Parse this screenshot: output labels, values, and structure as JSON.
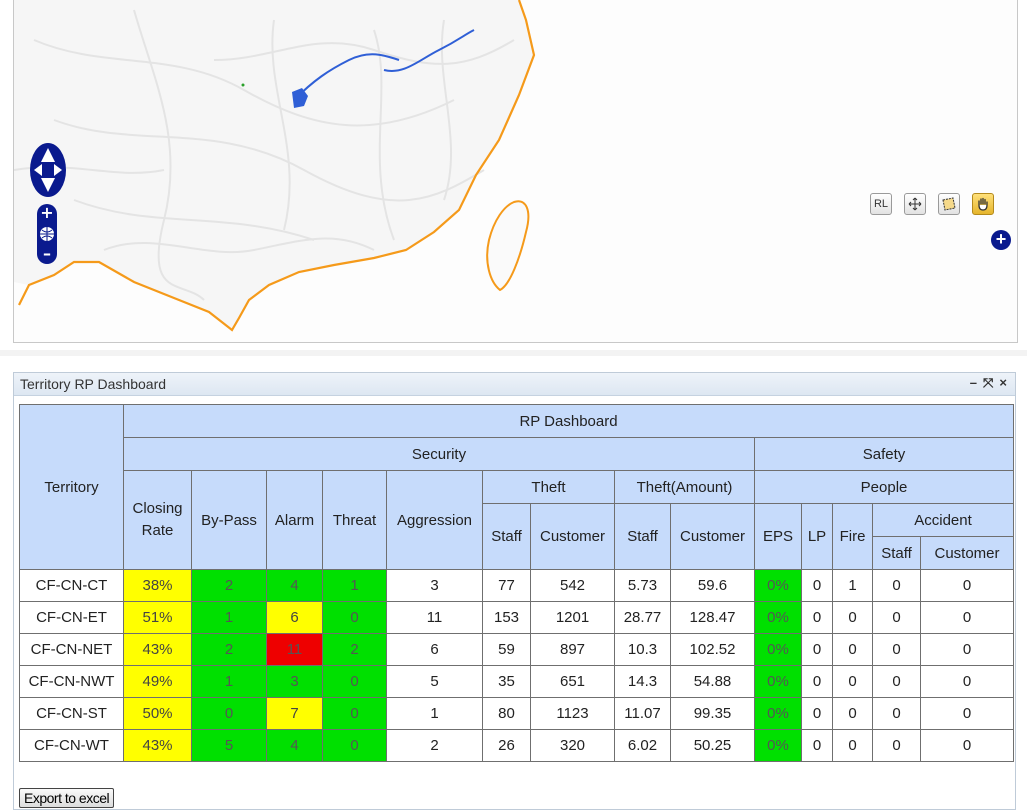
{
  "map": {
    "tools": [
      {
        "name": "rl-tool",
        "label": "RL"
      },
      {
        "name": "pan-tool",
        "label": ""
      },
      {
        "name": "select-area-tool",
        "label": ""
      },
      {
        "name": "hand-tool",
        "label": ""
      }
    ],
    "icons": {
      "pan": "pan-arrows-icon",
      "zoom": "zoom-bar-icon",
      "expand": "plus-circle-icon"
    },
    "expand_label": "+"
  },
  "dashboard": {
    "title": "Territory RP Dashboard",
    "controls": {
      "minimize": "–",
      "maximize": "⤧",
      "close": "×"
    },
    "headers": {
      "territory": "Territory",
      "rp_dashboard": "RP Dashboard",
      "security": "Security",
      "safety": "Safety",
      "closing_rate": "Closing Rate",
      "by_pass": "By-Pass",
      "alarm": "Alarm",
      "threat": "Threat",
      "aggression": "Aggression",
      "theft": "Theft",
      "theft_amount": "Theft(Amount)",
      "people": "People",
      "staff": "Staff",
      "customer": "Customer",
      "eps": "EPS",
      "lp": "LP",
      "fire": "Fire",
      "accident": "Accident"
    },
    "rows": [
      {
        "territory": "CF-CN-CT",
        "closing_rate": "38%",
        "by_pass": "2",
        "alarm": "4",
        "threat": "1",
        "aggression": "3",
        "theft_staff": "77",
        "theft_customer": "542",
        "amount_staff": "5.73",
        "amount_customer": "59.6",
        "eps": "0%",
        "lp": "0",
        "fire": "1",
        "accident_staff": "0",
        "accident_customer": "0"
      },
      {
        "territory": "CF-CN-ET",
        "closing_rate": "51%",
        "by_pass": "1",
        "alarm": "6",
        "threat": "0",
        "aggression": "11",
        "theft_staff": "153",
        "theft_customer": "1201",
        "amount_staff": "28.77",
        "amount_customer": "128.47",
        "eps": "0%",
        "lp": "0",
        "fire": "0",
        "accident_staff": "0",
        "accident_customer": "0"
      },
      {
        "territory": "CF-CN-NET",
        "closing_rate": "43%",
        "by_pass": "2",
        "alarm": "11",
        "threat": "2",
        "aggression": "6",
        "theft_staff": "59",
        "theft_customer": "897",
        "amount_staff": "10.3",
        "amount_customer": "102.52",
        "eps": "0%",
        "lp": "0",
        "fire": "0",
        "accident_staff": "0",
        "accident_customer": "0"
      },
      {
        "territory": "CF-CN-NWT",
        "closing_rate": "49%",
        "by_pass": "1",
        "alarm": "3",
        "threat": "0",
        "aggression": "5",
        "theft_staff": "35",
        "theft_customer": "651",
        "amount_staff": "14.3",
        "amount_customer": "54.88",
        "eps": "0%",
        "lp": "0",
        "fire": "0",
        "accident_staff": "0",
        "accident_customer": "0"
      },
      {
        "territory": "CF-CN-ST",
        "closing_rate": "50%",
        "by_pass": "0",
        "alarm": "7",
        "threat": "0",
        "aggression": "1",
        "theft_staff": "80",
        "theft_customer": "1123",
        "amount_staff": "11.07",
        "amount_customer": "99.35",
        "eps": "0%",
        "lp": "0",
        "fire": "0",
        "accident_staff": "0",
        "accident_customer": "0"
      },
      {
        "territory": "CF-CN-WT",
        "closing_rate": "43%",
        "by_pass": "5",
        "alarm": "4",
        "threat": "0",
        "aggression": "2",
        "theft_staff": "26",
        "theft_customer": "320",
        "amount_staff": "6.02",
        "amount_customer": "50.25",
        "eps": "0%",
        "lp": "0",
        "fire": "0",
        "accident_staff": "0",
        "accident_customer": "0"
      }
    ],
    "cell_colors": {
      "closing_rate": [
        "yellow",
        "yellow",
        "yellow",
        "yellow",
        "yellow",
        "yellow"
      ],
      "by_pass": [
        "green",
        "green",
        "green",
        "green",
        "green",
        "green"
      ],
      "alarm": [
        "green",
        "yellow",
        "red",
        "green",
        "yellow",
        "green"
      ],
      "threat": [
        "green",
        "green",
        "green",
        "green",
        "green",
        "green"
      ],
      "eps": [
        "green",
        "green",
        "green",
        "green",
        "green",
        "green"
      ]
    },
    "colors": {
      "green": "#00e000",
      "yellow": "#ffff00",
      "red": "#ee0000",
      "header": "#c6dbfb",
      "coast": "#f59a1a",
      "water": "#2f5fd6"
    },
    "export_label": "Export to excel"
  }
}
